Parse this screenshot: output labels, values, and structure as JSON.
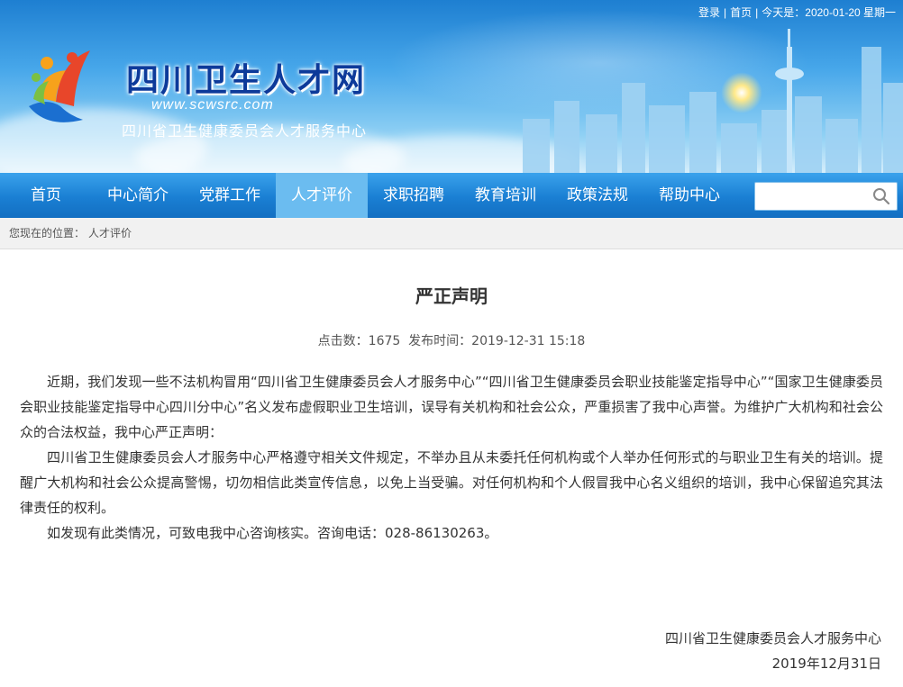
{
  "header": {
    "top_links": {
      "login": "登录",
      "home": "首页",
      "today": "今天是：2020-01-20 星期一"
    },
    "site_title": "四川卫生人才网",
    "site_url": "www.scwsrc.com",
    "site_subtitle": "四川省卫生健康委员会人才服务中心"
  },
  "nav": {
    "items": [
      {
        "label": "首页"
      },
      {
        "label": "中心简介"
      },
      {
        "label": "党群工作"
      },
      {
        "label": "人才评价"
      },
      {
        "label": "求职招聘"
      },
      {
        "label": "教育培训"
      },
      {
        "label": "政策法规"
      },
      {
        "label": "帮助中心"
      }
    ],
    "active_index": 3,
    "search_placeholder": ""
  },
  "breadcrumb": {
    "label": "您现在的位置：",
    "current": "人才评价"
  },
  "article": {
    "title": "严正声明",
    "meta": "点击数：1675  发布时间：2019-12-31 15:18",
    "paragraphs": [
      "近期，我们发现一些不法机构冒用“四川省卫生健康委员会人才服务中心”“四川省卫生健康委员会职业技能鉴定指导中心”“国家卫生健康委员会职业技能鉴定指导中心四川分中心”名义发布虚假职业卫生培训，误导有关机构和社会公众，严重损害了我中心声誉。为维护广大机构和社会公众的合法权益，我中心严正声明：",
      "四川省卫生健康委员会人才服务中心严格遵守相关文件规定，不举办且从未委托任何机构或个人举办任何形式的与职业卫生有关的培训。提醒广大机构和社会公众提高警惕，切勿相信此类宣传信息，以免上当受骗。对任何机构和个人假冒我中心名义组织的培训，我中心保留追究其法律责任的权利。",
      "如发现有此类情况，可致电我中心咨询核实。咨询电话：028-86130263。"
    ],
    "signature_org": "四川省卫生健康委员会人才服务中心",
    "signature_date": "2019年12月31日"
  },
  "colors": {
    "nav_bg": "#1a7fd3",
    "nav_active": "#6bbcf0",
    "title_blue": "#0d3a9a"
  }
}
